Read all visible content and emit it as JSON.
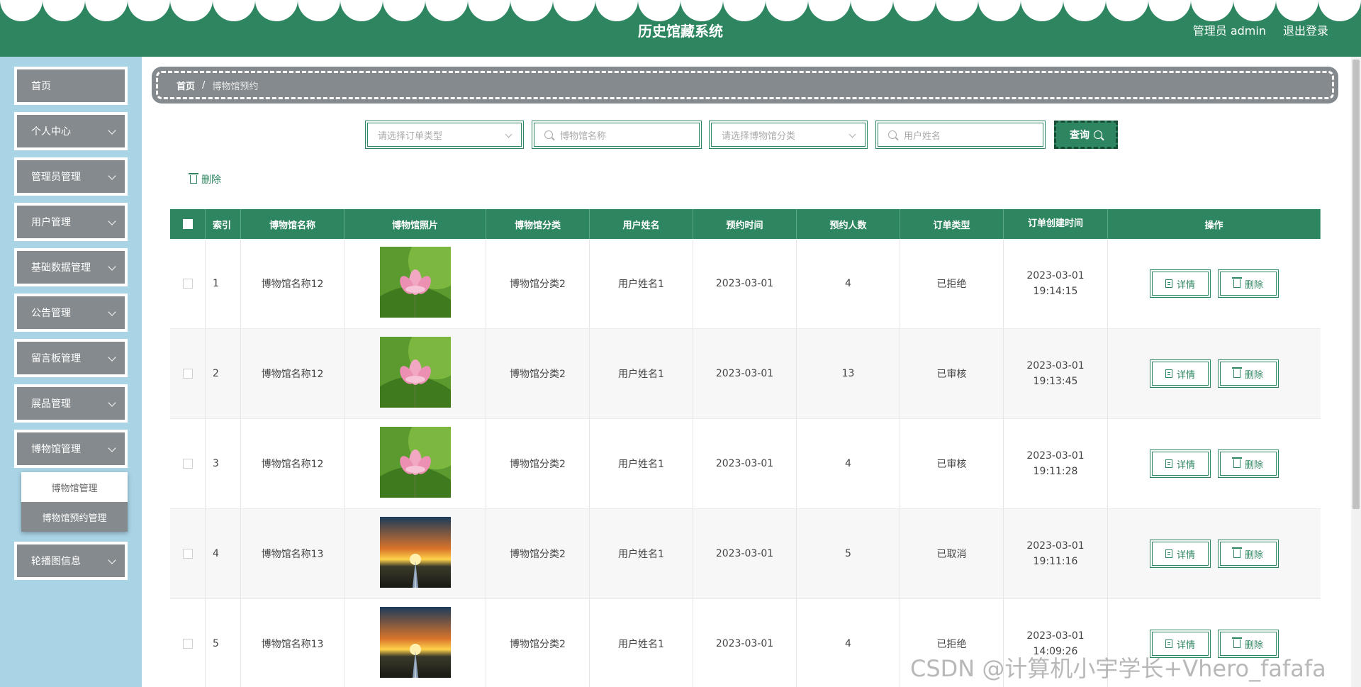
{
  "header": {
    "title": "历史馆藏系统",
    "admin_label": "管理员 admin",
    "logout_label": "退出登录"
  },
  "sidebar": {
    "items": [
      {
        "label": "首页"
      },
      {
        "label": "个人中心"
      },
      {
        "label": "管理员管理"
      },
      {
        "label": "用户管理"
      },
      {
        "label": "基础数据管理"
      },
      {
        "label": "公告管理"
      },
      {
        "label": "留言板管理"
      },
      {
        "label": "展品管理"
      },
      {
        "label": "博物馆管理"
      },
      {
        "label": "轮播图信息"
      }
    ],
    "submenu": [
      {
        "label": "博物馆管理"
      },
      {
        "label": "博物馆预约管理"
      }
    ]
  },
  "breadcrumb": {
    "home": "首页",
    "separator": "/",
    "current": "博物馆预约"
  },
  "filters": {
    "order_type_placeholder": "请选择订单类型",
    "museum_name_placeholder": "博物馆名称",
    "museum_category_placeholder": "请选择博物馆分类",
    "user_name_placeholder": "用户姓名",
    "query_label": "查询"
  },
  "actions": {
    "delete_label": "删除"
  },
  "table": {
    "columns": [
      "索引",
      "博物馆名称",
      "博物馆照片",
      "博物馆分类",
      "用户姓名",
      "预约时间",
      "预约人数",
      "订单类型",
      "订单创建时间",
      "操作"
    ],
    "detail_label": "详情",
    "delete_label": "删除",
    "rows": [
      {
        "index": "1",
        "name": "博物馆名称12",
        "image": "lotus",
        "category": "博物馆分类2",
        "user": "用户姓名1",
        "date": "2023-03-01",
        "count": "4",
        "type": "已拒绝",
        "created": "2023-03-01 19:14:15"
      },
      {
        "index": "2",
        "name": "博物馆名称12",
        "image": "lotus",
        "category": "博物馆分类2",
        "user": "用户姓名1",
        "date": "2023-03-01",
        "count": "13",
        "type": "已审核",
        "created": "2023-03-01 19:13:45"
      },
      {
        "index": "3",
        "name": "博物馆名称12",
        "image": "lotus",
        "category": "博物馆分类2",
        "user": "用户姓名1",
        "date": "2023-03-01",
        "count": "4",
        "type": "已审核",
        "created": "2023-03-01 19:11:28"
      },
      {
        "index": "4",
        "name": "博物馆名称13",
        "image": "sunset",
        "category": "博物馆分类2",
        "user": "用户姓名1",
        "date": "2023-03-01",
        "count": "5",
        "type": "已取消",
        "created": "2023-03-01 19:11:16"
      },
      {
        "index": "5",
        "name": "博物馆名称13",
        "image": "sunset",
        "category": "博物馆分类2",
        "user": "用户姓名1",
        "date": "2023-03-01",
        "count": "4",
        "type": "已拒绝",
        "created": "2023-03-01 14:09:26"
      }
    ]
  },
  "watermark": "CSDN @计算机小宇学长+Vhero_fafafa",
  "colors": {
    "primary": "#2e8660",
    "sidebar_bg": "#a9d4e6",
    "menu_bg": "#848a8d"
  }
}
